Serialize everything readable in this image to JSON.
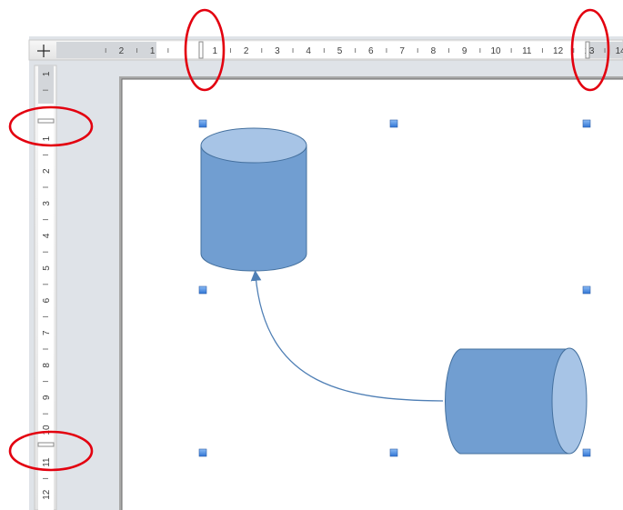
{
  "rulers": {
    "horizontal_labels": [
      "2",
      "1",
      "1",
      "2",
      "3",
      "4",
      "5",
      "6",
      "7",
      "8",
      "9",
      "10",
      "11",
      "12",
      "13",
      "14"
    ],
    "vertical_labels": [
      "1",
      "1",
      "2",
      "3",
      "4",
      "5",
      "6",
      "7",
      "8",
      "9",
      "10",
      "11",
      "12"
    ],
    "corner_symbol": "+"
  },
  "annotations": {
    "circle_color": "#e3000f",
    "count": 4
  },
  "shapes": {
    "fill_color": "#719ed1",
    "top_fill_color": "#a7c4e6",
    "stroke_color": "#44709e",
    "handle_color": "#4a8ee6"
  }
}
